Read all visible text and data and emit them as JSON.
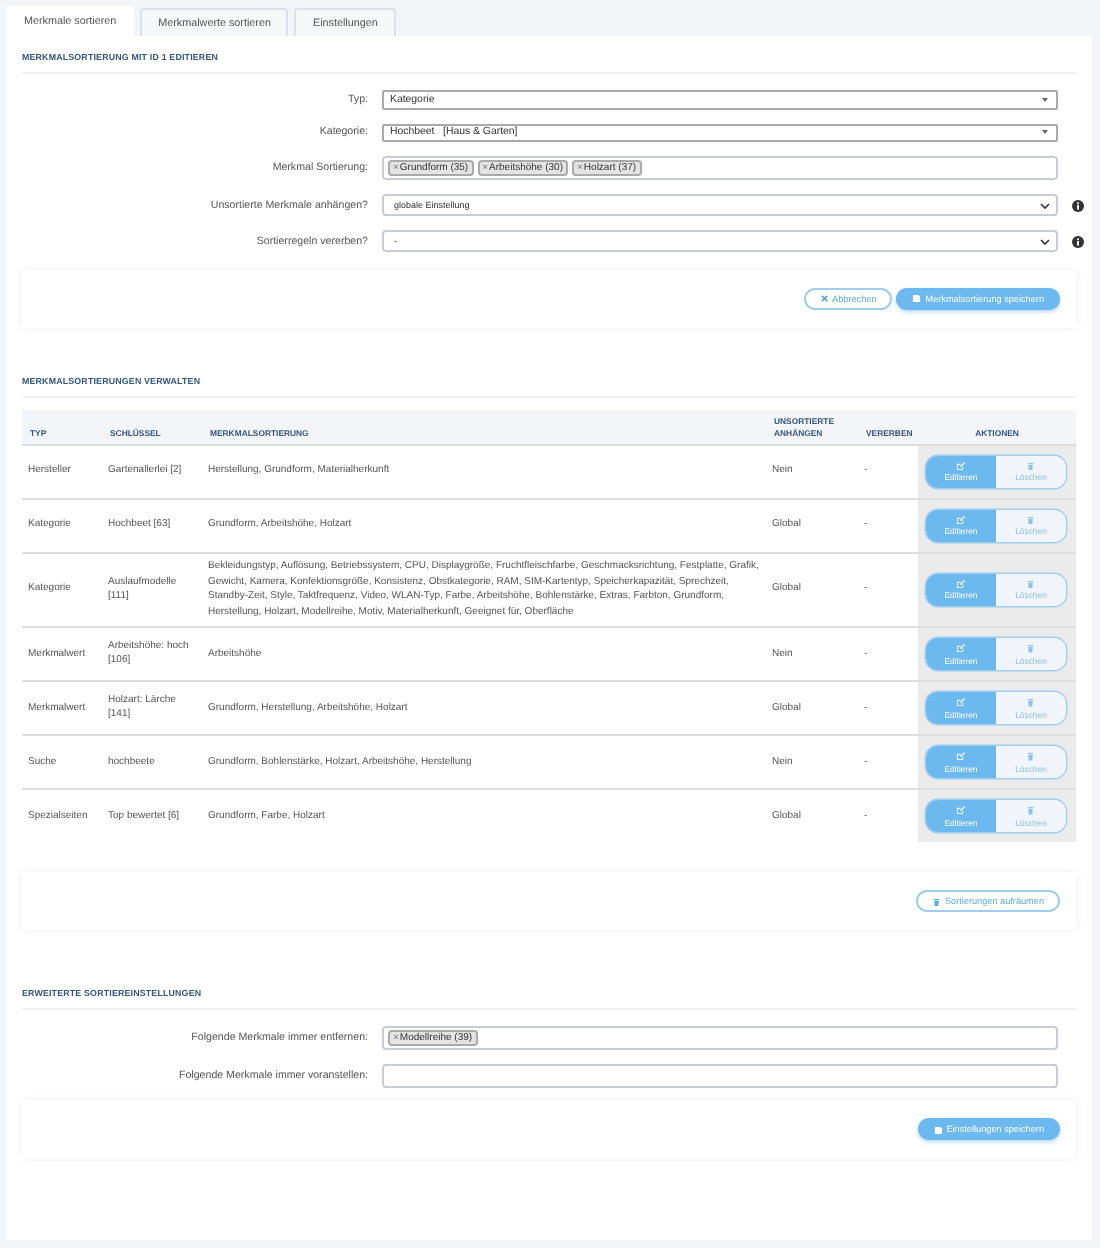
{
  "tabs": [
    {
      "label": "Merkmale sortieren",
      "selected": true
    },
    {
      "label": "Merkmalwerte sortieren",
      "selected": false
    },
    {
      "label": "Einstellungen",
      "selected": false
    }
  ],
  "edit_section": {
    "title": "MERKMALSORTIERUNG MIT ID 1 EDITIEREN",
    "fields": [
      {
        "kind": "select",
        "label": "Typ:",
        "value": "Kategorie",
        "info": false
      },
      {
        "kind": "select",
        "label": "Kategorie:",
        "value": "Hochbeet   [Haus & Garten]",
        "info": false
      },
      {
        "kind": "tags",
        "label": "Merkmal Sortierung:",
        "tags": [
          {
            "remove": "×",
            "label": "Grundform (35)"
          },
          {
            "remove": "×",
            "label": "Arbeitshöhe (30)"
          },
          {
            "remove": "×",
            "label": "Holzart (37)"
          }
        ],
        "info": false
      },
      {
        "kind": "native-select",
        "label": "Unsortierte Merkmale anhängen?",
        "value": "globale Einstellung",
        "info": true
      },
      {
        "kind": "native-select",
        "label": "Sortierregeln vererben?",
        "value": "-",
        "info": true
      }
    ],
    "buttons": [
      {
        "kind": "cancel",
        "label": "Abbrechen"
      },
      {
        "kind": "save",
        "label": "Merkmalsortierung speichern"
      }
    ]
  },
  "manage_section": {
    "title": "MERKMALSORTIERUNGEN VERWALTEN",
    "columns": [
      "TYP",
      "SCHLÜSSEL",
      "MERKMALSORTIERUNG",
      "UNSORTIERTE ANHÄNGEN",
      "VERERBEN",
      "AKTIONEN"
    ],
    "rows": [
      {
        "typ": "Hersteller",
        "key": "Gartenallerlei [2]",
        "sorting": "Herstellung, Grundform, Materialherkunft",
        "unsorted": "Nein",
        "inherit": "-",
        "actions": [
          {
            "kind": "edit",
            "label": "Editieren"
          },
          {
            "kind": "delete",
            "label": "Löschen"
          }
        ]
      },
      {
        "typ": "Kategorie",
        "key": "Hochbeet [63]",
        "sorting": "Grundform, Arbeitshöhe, Holzart",
        "unsorted": "Global",
        "inherit": "-",
        "actions": [
          {
            "kind": "edit",
            "label": "Editieren"
          },
          {
            "kind": "delete",
            "label": "Löschen"
          }
        ]
      },
      {
        "typ": "Kategorie",
        "key": "Auslaufmodelle [111]",
        "sorting": "Bekleidungstyp, Auflösung, Betriebssystem, CPU, Displaygröße, Fruchtfleischfarbe, Geschmacksrichtung, Festplatte, Grafik, Gewicht, Kamera, Konfektionsgröße, Konsistenz, Obstkategorie, RAM, SIM-Kartentyp, Speicherkapazität, Sprechzeit, Standby-Zeit, Style, Taktfrequenz, Video, WLAN-Typ, Farbe, Arbeitshöhe, Bohlenstärke, Extras, Farbton, Grundform, Herstellung, Holzart, Modellreihe, Motiv, Materialherkunft, Geeignet für, Oberfläche",
        "unsorted": "Global",
        "inherit": "-",
        "actions": [
          {
            "kind": "edit",
            "label": "Editieren"
          },
          {
            "kind": "delete",
            "label": "Löschen"
          }
        ]
      },
      {
        "typ": "Merkmalwert",
        "key": "Arbeitshöhe: hoch [106]",
        "sorting": "Arbeitshöhe",
        "unsorted": "Nein",
        "inherit": "-",
        "actions": [
          {
            "kind": "edit",
            "label": "Editieren"
          },
          {
            "kind": "delete",
            "label": "Löschen"
          }
        ]
      },
      {
        "typ": "Merkmalwert",
        "key": "Holzart: Lärche [141]",
        "sorting": "Grundform, Herstellung, Arbeitshöhe, Holzart",
        "unsorted": "Global",
        "inherit": "-",
        "actions": [
          {
            "kind": "edit",
            "label": "Editieren"
          },
          {
            "kind": "delete",
            "label": "Löschen"
          }
        ]
      },
      {
        "typ": "Suche",
        "key": "hochbeete",
        "sorting": "Grundform, Bohlenstärke, Holzart, Arbeitshöhe, Herstellung",
        "unsorted": "Nein",
        "inherit": "-",
        "actions": [
          {
            "kind": "edit",
            "label": "Editieren"
          },
          {
            "kind": "delete",
            "label": "Löschen"
          }
        ]
      },
      {
        "typ": "Spezialseiten",
        "key": "Top bewertet [6]",
        "sorting": "Grundform, Farbe, Holzart",
        "unsorted": "Global",
        "inherit": "-",
        "actions": [
          {
            "kind": "edit",
            "label": "Editieren"
          },
          {
            "kind": "delete",
            "label": "Löschen"
          }
        ]
      }
    ],
    "buttons": [
      {
        "kind": "cleanup",
        "label": "Sortierungen aufräumen"
      }
    ]
  },
  "advanced_section": {
    "title": "ERWEITERTE SORTIEREINSTELLUNGEN",
    "fields": [
      {
        "kind": "tags",
        "label": "Folgende Merkmale immer entfernen:",
        "tags": [
          {
            "remove": "×",
            "label": "Modellreihe (39)"
          }
        ],
        "info": false
      },
      {
        "kind": "text",
        "label": "Folgende Merkmale immer voranstellen:",
        "info": false
      }
    ],
    "buttons": [
      {
        "kind": "save",
        "label": "Einstellungen speichern"
      }
    ]
  }
}
